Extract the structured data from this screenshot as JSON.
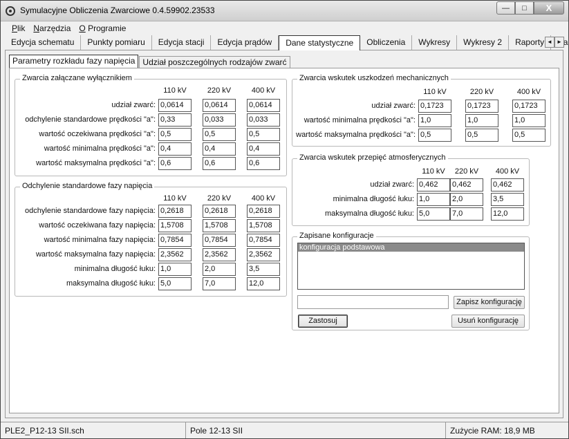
{
  "window": {
    "title": "Symulacyjne Obliczenia Zwarciowe 0.4.59902.23533",
    "minimize": "—",
    "maximize": "□",
    "close": "X"
  },
  "menu": [
    {
      "accel": "P",
      "rest": "lik"
    },
    {
      "accel": "N",
      "rest": "arzędzia"
    },
    {
      "accel": "O",
      "rest": " Programie"
    }
  ],
  "tabs": [
    "Edycja schematu",
    "Punkty pomiaru",
    "Edycja stacji",
    "Edycja prądów",
    "Dane statystyczne",
    "Obliczenia",
    "Wykresy",
    "Wykresy 2",
    "Raporty",
    "Da"
  ],
  "tab_scroll": {
    "left": "◄",
    "right": "►"
  },
  "subtabs": [
    "Parametry rozkładu fazy napięcia",
    "Udział poszczególnych rodzajów zwarć"
  ],
  "columns": [
    "110 kV",
    "220 kV",
    "400 kV"
  ],
  "group1": {
    "title": "Zwarcia załączane wyłącznikiem",
    "rows": [
      {
        "label": "udział zwarć:",
        "values": [
          "0,0614",
          "0,0614",
          "0,0614"
        ]
      },
      {
        "label": "odchylenie standardowe prędkości \"a\":",
        "values": [
          "0,33",
          "0,033",
          "0,033"
        ]
      },
      {
        "label": "wartość oczekiwana prędkości \"a\":",
        "values": [
          "0,5",
          "0,5",
          "0,5"
        ]
      },
      {
        "label": "wartość minimalna prędkości \"a\":",
        "values": [
          "0,4",
          "0,4",
          "0,4"
        ]
      },
      {
        "label": "wartość maksymalna prędkości \"a\":",
        "values": [
          "0,6",
          "0,6",
          "0,6"
        ]
      }
    ]
  },
  "group2": {
    "title": "Odchylenie standardowe fazy napięcia",
    "rows": [
      {
        "label": "odchylenie standardowe fazy napięcia:",
        "values": [
          "0,2618",
          "0,2618",
          "0,2618"
        ]
      },
      {
        "label": "wartość oczekiwana fazy napięcia:",
        "values": [
          "1,5708",
          "1,5708",
          "1,5708"
        ]
      },
      {
        "label": "wartość minimalna fazy napięcia:",
        "values": [
          "0,7854",
          "0,7854",
          "0,7854"
        ]
      },
      {
        "label": "wartość maksymalna fazy napięcia:",
        "values": [
          "2,3562",
          "2,3562",
          "2,3562"
        ]
      },
      {
        "label": "minimalna długość łuku:",
        "values": [
          "1,0",
          "2,0",
          "3,5"
        ]
      },
      {
        "label": "maksymalna długość łuku:",
        "values": [
          "5,0",
          "7,0",
          "12,0"
        ]
      }
    ]
  },
  "group3": {
    "title": "Zwarcia wskutek uszkodzeń mechanicznych",
    "rows": [
      {
        "label": "udział zwarć:",
        "values": [
          "0,1723",
          "0,1723",
          "0,1723"
        ]
      },
      {
        "label": "wartość minimalna prędkości \"a\":",
        "values": [
          "1,0",
          "1,0",
          "1,0"
        ]
      },
      {
        "label": "wartość maksymalna prędkości \"a\":",
        "values": [
          "0,5",
          "0,5",
          "0,5"
        ]
      }
    ]
  },
  "group4": {
    "title": "Zwarcia wskutek przepięć atmosferycznych",
    "rows": [
      {
        "label": "udział zwarć:",
        "values": [
          "0,462",
          "0,462",
          "0,462"
        ]
      },
      {
        "label": "minimalna długość łuku:",
        "values": [
          "1,0",
          "2,0",
          "3,5"
        ]
      },
      {
        "label": "maksymalna długość łuku:",
        "values": [
          "5,0",
          "7,0",
          "12,0"
        ]
      }
    ]
  },
  "configs": {
    "title": "Zapisane konfiguracje",
    "items": [
      "konfiguracja podstawowa"
    ],
    "name_value": "",
    "save_label": "Zapisz konfigurację",
    "apply_label": "Zastosuj",
    "delete_label": "Usuń konfigurację"
  },
  "status": {
    "file": "PLE2_P12-13 SII.sch",
    "field": "Pole 12-13 SII",
    "ram": "Zużycie RAM: 18,9 MB"
  }
}
